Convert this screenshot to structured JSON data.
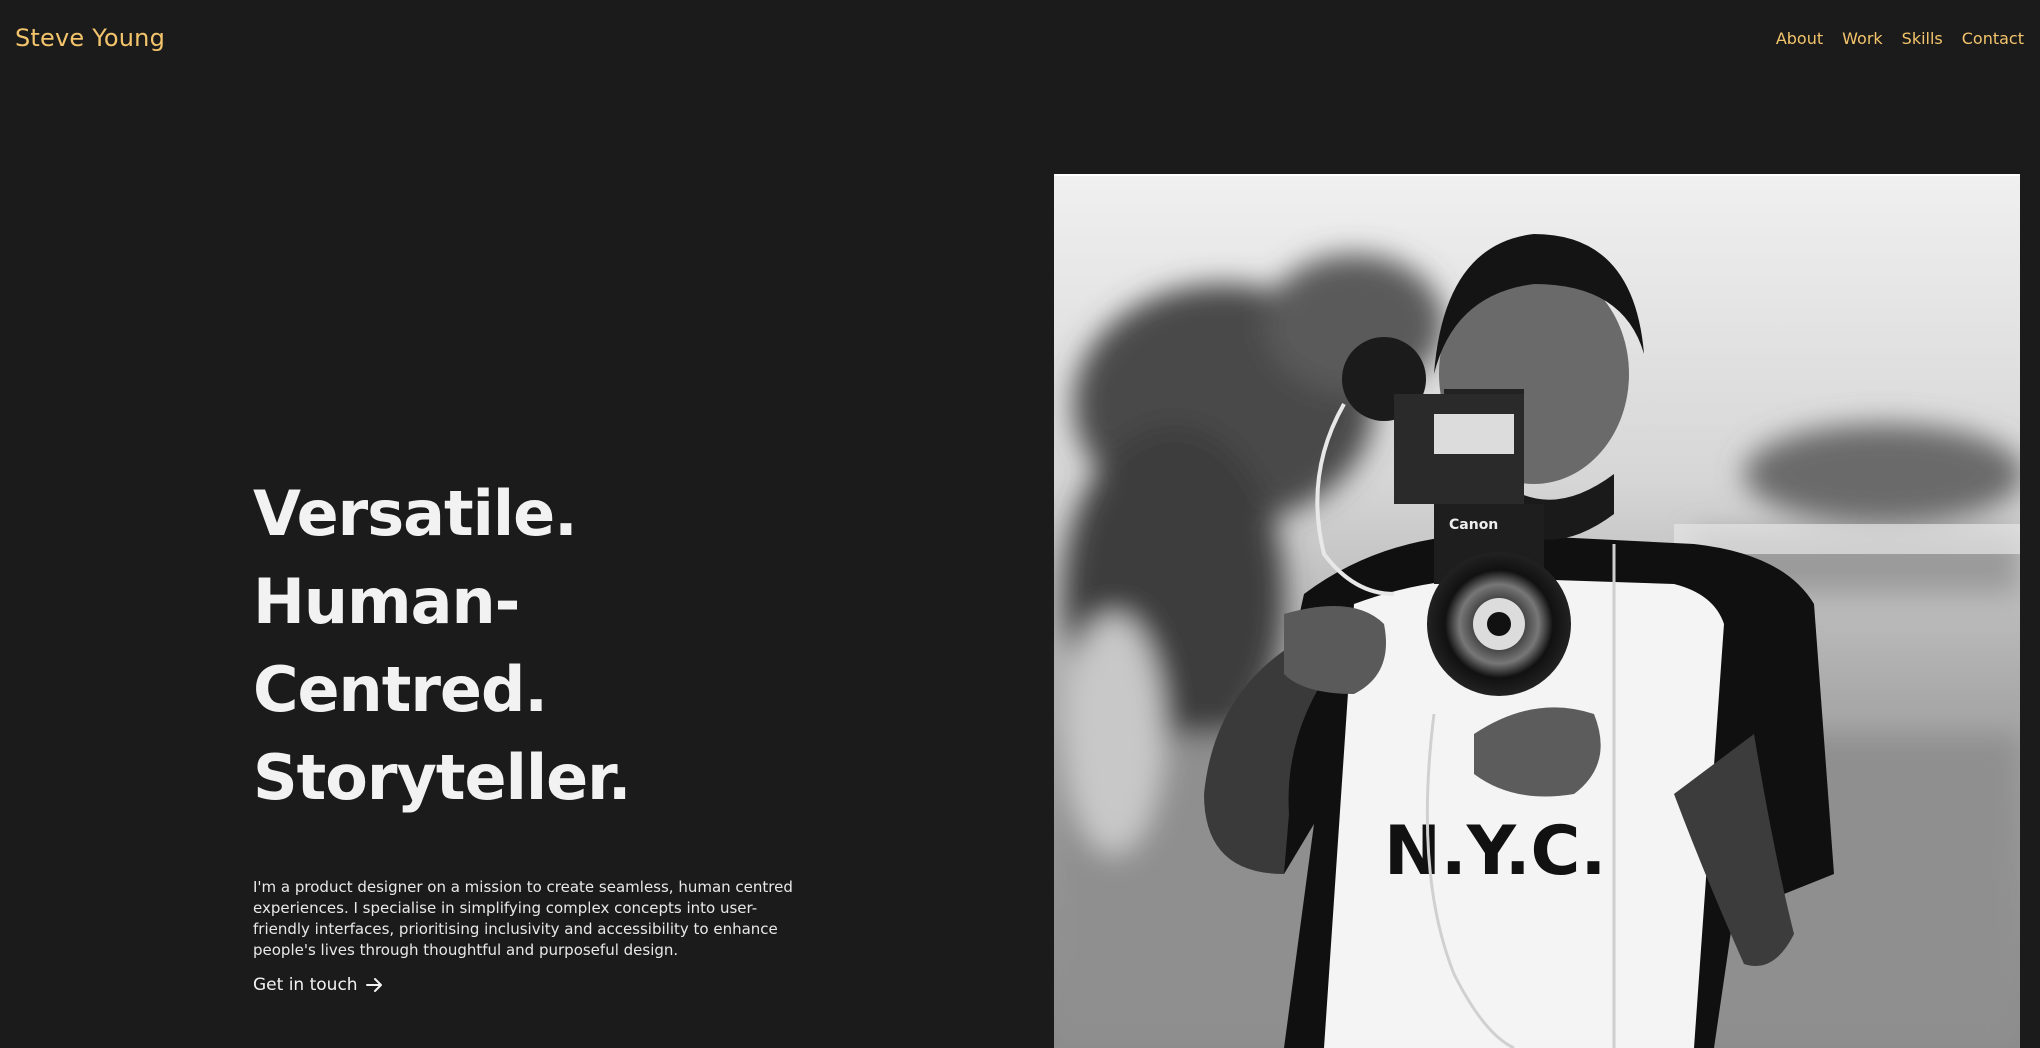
{
  "brand": {
    "name": "Steve Young"
  },
  "nav": {
    "items": [
      {
        "label": "About"
      },
      {
        "label": "Work"
      },
      {
        "label": "Skills"
      },
      {
        "label": "Contact"
      }
    ]
  },
  "hero": {
    "headline": [
      "Versatile.",
      "Human-Centred.",
      "Storyteller."
    ],
    "intro": "I'm a product designer on a mission to create seamless, human centred experiences. I specialise in simplifying complex concepts into user-friendly interfaces, prioritising inclusivity and accessibility to enhance people's lives through thoughtful and purposeful design.",
    "cta_label": "Get in touch",
    "cta_icon": "arrow-right-icon"
  },
  "photo": {
    "shirt_text": "N.Y.C.",
    "camera_text": "Canon"
  },
  "colors": {
    "background": "#1b1b1b",
    "accent": "#f3c46b",
    "text": "#f2f2f2"
  }
}
